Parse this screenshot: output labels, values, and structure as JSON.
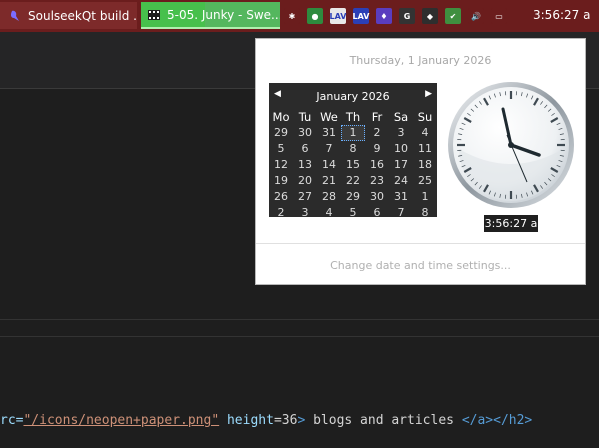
{
  "taskbar": {
    "tasks": [
      {
        "label": "SoulseekQt build ..."
      },
      {
        "label": "5-05. Junky - Swe..."
      }
    ],
    "tray_icons": [
      {
        "name": "notification-icon",
        "text": "✱",
        "color": "#6b1d1d"
      },
      {
        "name": "green-circle-icon",
        "text": "●",
        "color": "#2e8b3e"
      },
      {
        "name": "lav-icon",
        "text": "LAV",
        "color": "#e8e8e8"
      },
      {
        "name": "lav-blue-icon",
        "text": "LAV",
        "color": "#2b3fb6"
      },
      {
        "name": "wizard-icon",
        "text": "♦",
        "color": "#5a3dbf"
      },
      {
        "name": "google-icon",
        "text": "G",
        "color": "#333333"
      },
      {
        "name": "shield-icon",
        "text": "◆",
        "color": "#2e2e2e"
      },
      {
        "name": "security-check-icon",
        "text": "✔",
        "color": "#3f8f3f"
      },
      {
        "name": "volume-icon",
        "text": "🔊",
        "color": "#6b1d1d"
      },
      {
        "name": "action-center-icon",
        "text": "▭",
        "color": "#6b1d1d"
      }
    ],
    "clock": "3:56:27 a"
  },
  "popup": {
    "long_date": "Thursday, 1 January 2026",
    "calendar": {
      "title": "January 2026",
      "weekdays": [
        "Mo",
        "Tu",
        "We",
        "Th",
        "Fr",
        "Sa",
        "Su"
      ],
      "weeks": [
        [
          "29",
          "30",
          "31",
          "1",
          "2",
          "3",
          "4"
        ],
        [
          "5",
          "6",
          "7",
          "8",
          "9",
          "10",
          "11"
        ],
        [
          "12",
          "13",
          "14",
          "15",
          "16",
          "17",
          "18"
        ],
        [
          "19",
          "20",
          "21",
          "22",
          "23",
          "24",
          "25"
        ],
        [
          "26",
          "27",
          "28",
          "29",
          "30",
          "31",
          "1"
        ],
        [
          "2",
          "3",
          "4",
          "5",
          "6",
          "7",
          "8"
        ]
      ],
      "today": "1"
    },
    "time": "3:56:27 a",
    "settings_link": "Change date and time settings..."
  },
  "editor": {
    "code": {
      "prefix": "rc=",
      "src": "\"/icons/neopen+paper.png\"",
      "attr2": " height",
      "eq2": "=36",
      "gt": ">",
      "text": " blogs and articles ",
      "close": "</a></h2>"
    }
  },
  "colors": {
    "taskbar": "#6b1d1d",
    "active_task": "#47c04c",
    "calendar_bg": "#2b2b2b"
  }
}
